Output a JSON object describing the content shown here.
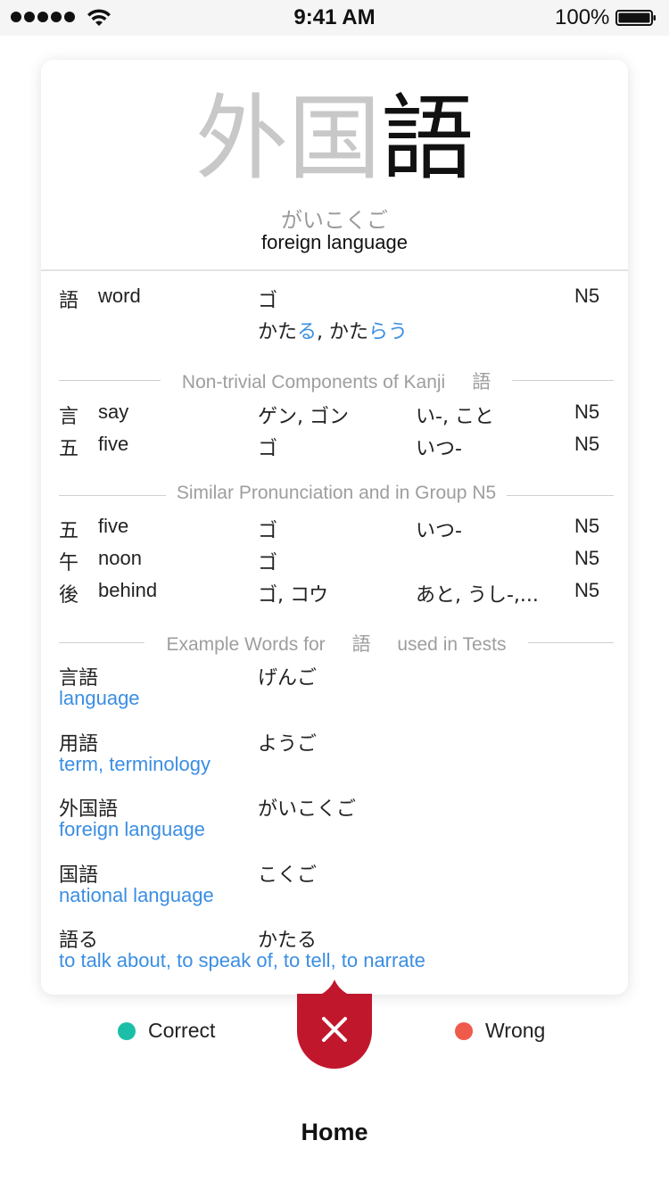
{
  "status_bar": {
    "time": "9:41 AM",
    "battery_percent": "100%",
    "icons": [
      "signal-dots-icon",
      "wifi-icon",
      "battery-icon"
    ]
  },
  "card": {
    "word_dim": "外国",
    "word_highlight": "語",
    "reading": "がいこくご",
    "meaning": "foreign language",
    "main_kanji": {
      "kanji": "語",
      "meaning": "word",
      "on": "ゴ",
      "kun_parts": [
        {
          "text": "かた",
          "blue": false
        },
        {
          "text": "る",
          "blue": true
        },
        {
          "text": ", かた",
          "blue": false
        },
        {
          "text": "らう",
          "blue": true
        }
      ],
      "level": "N5"
    },
    "sections": {
      "components_title": "Non-trivial Components of Kanji ",
      "components_kanji": "語",
      "similar_title": "Similar Pronunciation and in Group N5",
      "examples_title_pre": "Example Words for ",
      "examples_kanji": "語",
      "examples_title_post": " used in Tests"
    },
    "components": [
      {
        "kanji": "言",
        "meaning": "say",
        "on": "ゲン, ゴン",
        "kun": "い-, こと",
        "level": "N5"
      },
      {
        "kanji": "五",
        "meaning": "five",
        "on": "ゴ",
        "kun": "いつ-",
        "level": "N5"
      }
    ],
    "similar": [
      {
        "kanji": "五",
        "meaning": "five",
        "on": "ゴ",
        "kun": "いつ-",
        "level": "N5"
      },
      {
        "kanji": "午",
        "meaning": "noon",
        "on": "ゴ",
        "kun": "",
        "level": "N5"
      },
      {
        "kanji": "後",
        "meaning": "behind",
        "on": "ゴ, コウ",
        "kun": "あと, うし-,...",
        "level": "N5"
      }
    ],
    "examples": [
      {
        "word": "言語",
        "reading": "げんご",
        "meaning": "language"
      },
      {
        "word": "用語",
        "reading": "ようご",
        "meaning": "term, terminology"
      },
      {
        "word": "外国語",
        "reading": "がいこくご",
        "meaning": "foreign language"
      },
      {
        "word": "国語",
        "reading": "こくご",
        "meaning": "national language"
      },
      {
        "word": "語る",
        "reading": "かたる",
        "meaning": "to talk about, to speak of, to tell, to narrate"
      }
    ]
  },
  "controls": {
    "correct_label": "Correct",
    "wrong_label": "Wrong",
    "correct_color": "#1bbfa8",
    "wrong_color": "#ef5b4a",
    "close_color": "#c0172c",
    "close_icon": "close-icon"
  },
  "home_label": "Home"
}
